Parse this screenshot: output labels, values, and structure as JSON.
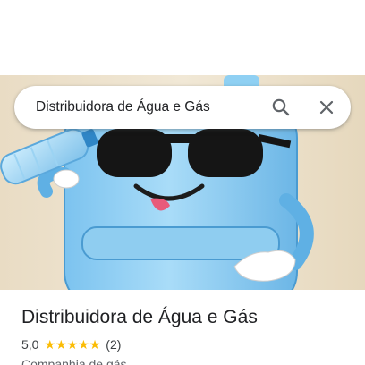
{
  "search": {
    "query": "Distribuidora de Água e Gás"
  },
  "place": {
    "title": "Distribuidora de Água e Gás",
    "rating": "5,0",
    "stars": [
      "★",
      "★",
      "★",
      "★",
      "★"
    ],
    "reviews": "(2)",
    "category": "Companhia de gás"
  },
  "icons": {
    "search": "search-icon",
    "close": "close-icon",
    "star": "star-icon"
  },
  "colors": {
    "star": "#fbbc04",
    "text_primary": "#202124",
    "text_secondary": "#5f6368"
  }
}
